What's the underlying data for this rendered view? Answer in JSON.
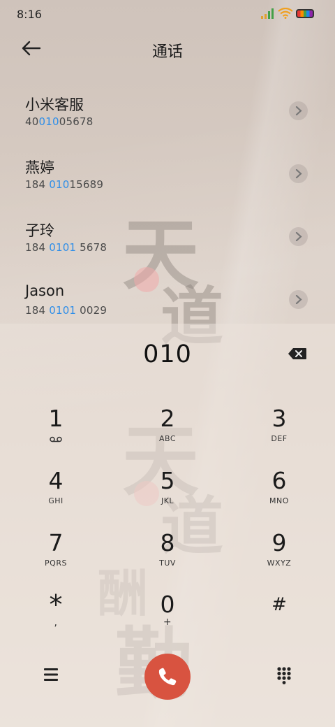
{
  "status_bar": {
    "time": "8:16"
  },
  "header": {
    "title": "通话"
  },
  "contacts": [
    {
      "name": "小米客服",
      "number_pre": "40",
      "number_hl": "010",
      "number_post": "05678"
    },
    {
      "name": "燕婷",
      "number_pre": "184 ",
      "number_hl": "010",
      "number_post": "15689"
    },
    {
      "name": "子玲",
      "number_pre": "184 ",
      "number_hl": "0101",
      "number_post": " 5678"
    },
    {
      "name": "Jason",
      "number_pre": "184 ",
      "number_hl": "0101",
      "number_post": " 0029"
    }
  ],
  "dialer": {
    "input_value": "010",
    "keys": [
      {
        "digit": "1",
        "letters": ""
      },
      {
        "digit": "2",
        "letters": "ABC"
      },
      {
        "digit": "3",
        "letters": "DEF"
      },
      {
        "digit": "4",
        "letters": "GHI"
      },
      {
        "digit": "5",
        "letters": "JKL"
      },
      {
        "digit": "6",
        "letters": "MNO"
      },
      {
        "digit": "7",
        "letters": "PQRS"
      },
      {
        "digit": "8",
        "letters": "TUV"
      },
      {
        "digit": "9",
        "letters": "WXYZ"
      },
      {
        "digit": "*",
        "letters": ","
      },
      {
        "digit": "0",
        "letters": "+"
      },
      {
        "digit": "#",
        "letters": ""
      }
    ]
  },
  "wallpaper": {
    "glyphs": [
      "天",
      "道",
      "天",
      "道",
      "酬",
      "勤"
    ]
  },
  "colors": {
    "highlight": "#2f8ee8",
    "call_button": "#d85340"
  }
}
